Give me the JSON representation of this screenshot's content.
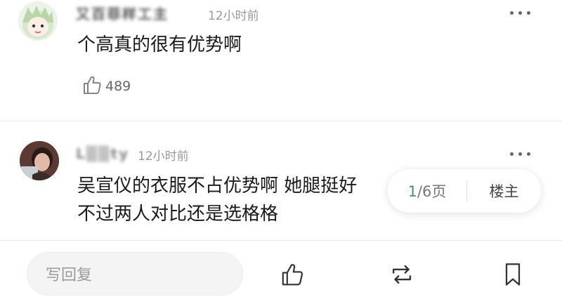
{
  "comments": [
    {
      "username": "又百菲样工主",
      "time": "12小时前",
      "text_lines": [
        "个高真的很有优势啊"
      ],
      "like_count": "489"
    },
    {
      "username": "L▒▒ty",
      "time": "12小时前",
      "text_lines": [
        "吴宣仪的衣服不占优势啊 她腿挺好",
        "不过两人对比还是选格格"
      ]
    }
  ],
  "pager": {
    "current": "1",
    "rest": "/6页",
    "owner_label": "楼主"
  },
  "bottom_bar": {
    "reply_placeholder": "写回复"
  },
  "icons": [
    "more-dots-icon",
    "thumbs-up-icon",
    "repost-icon",
    "bookmark-icon"
  ],
  "colors": {
    "accent_green": "#4a9b5b",
    "text_primary": "#1a1a1a",
    "text_secondary": "#9a9a9a"
  }
}
